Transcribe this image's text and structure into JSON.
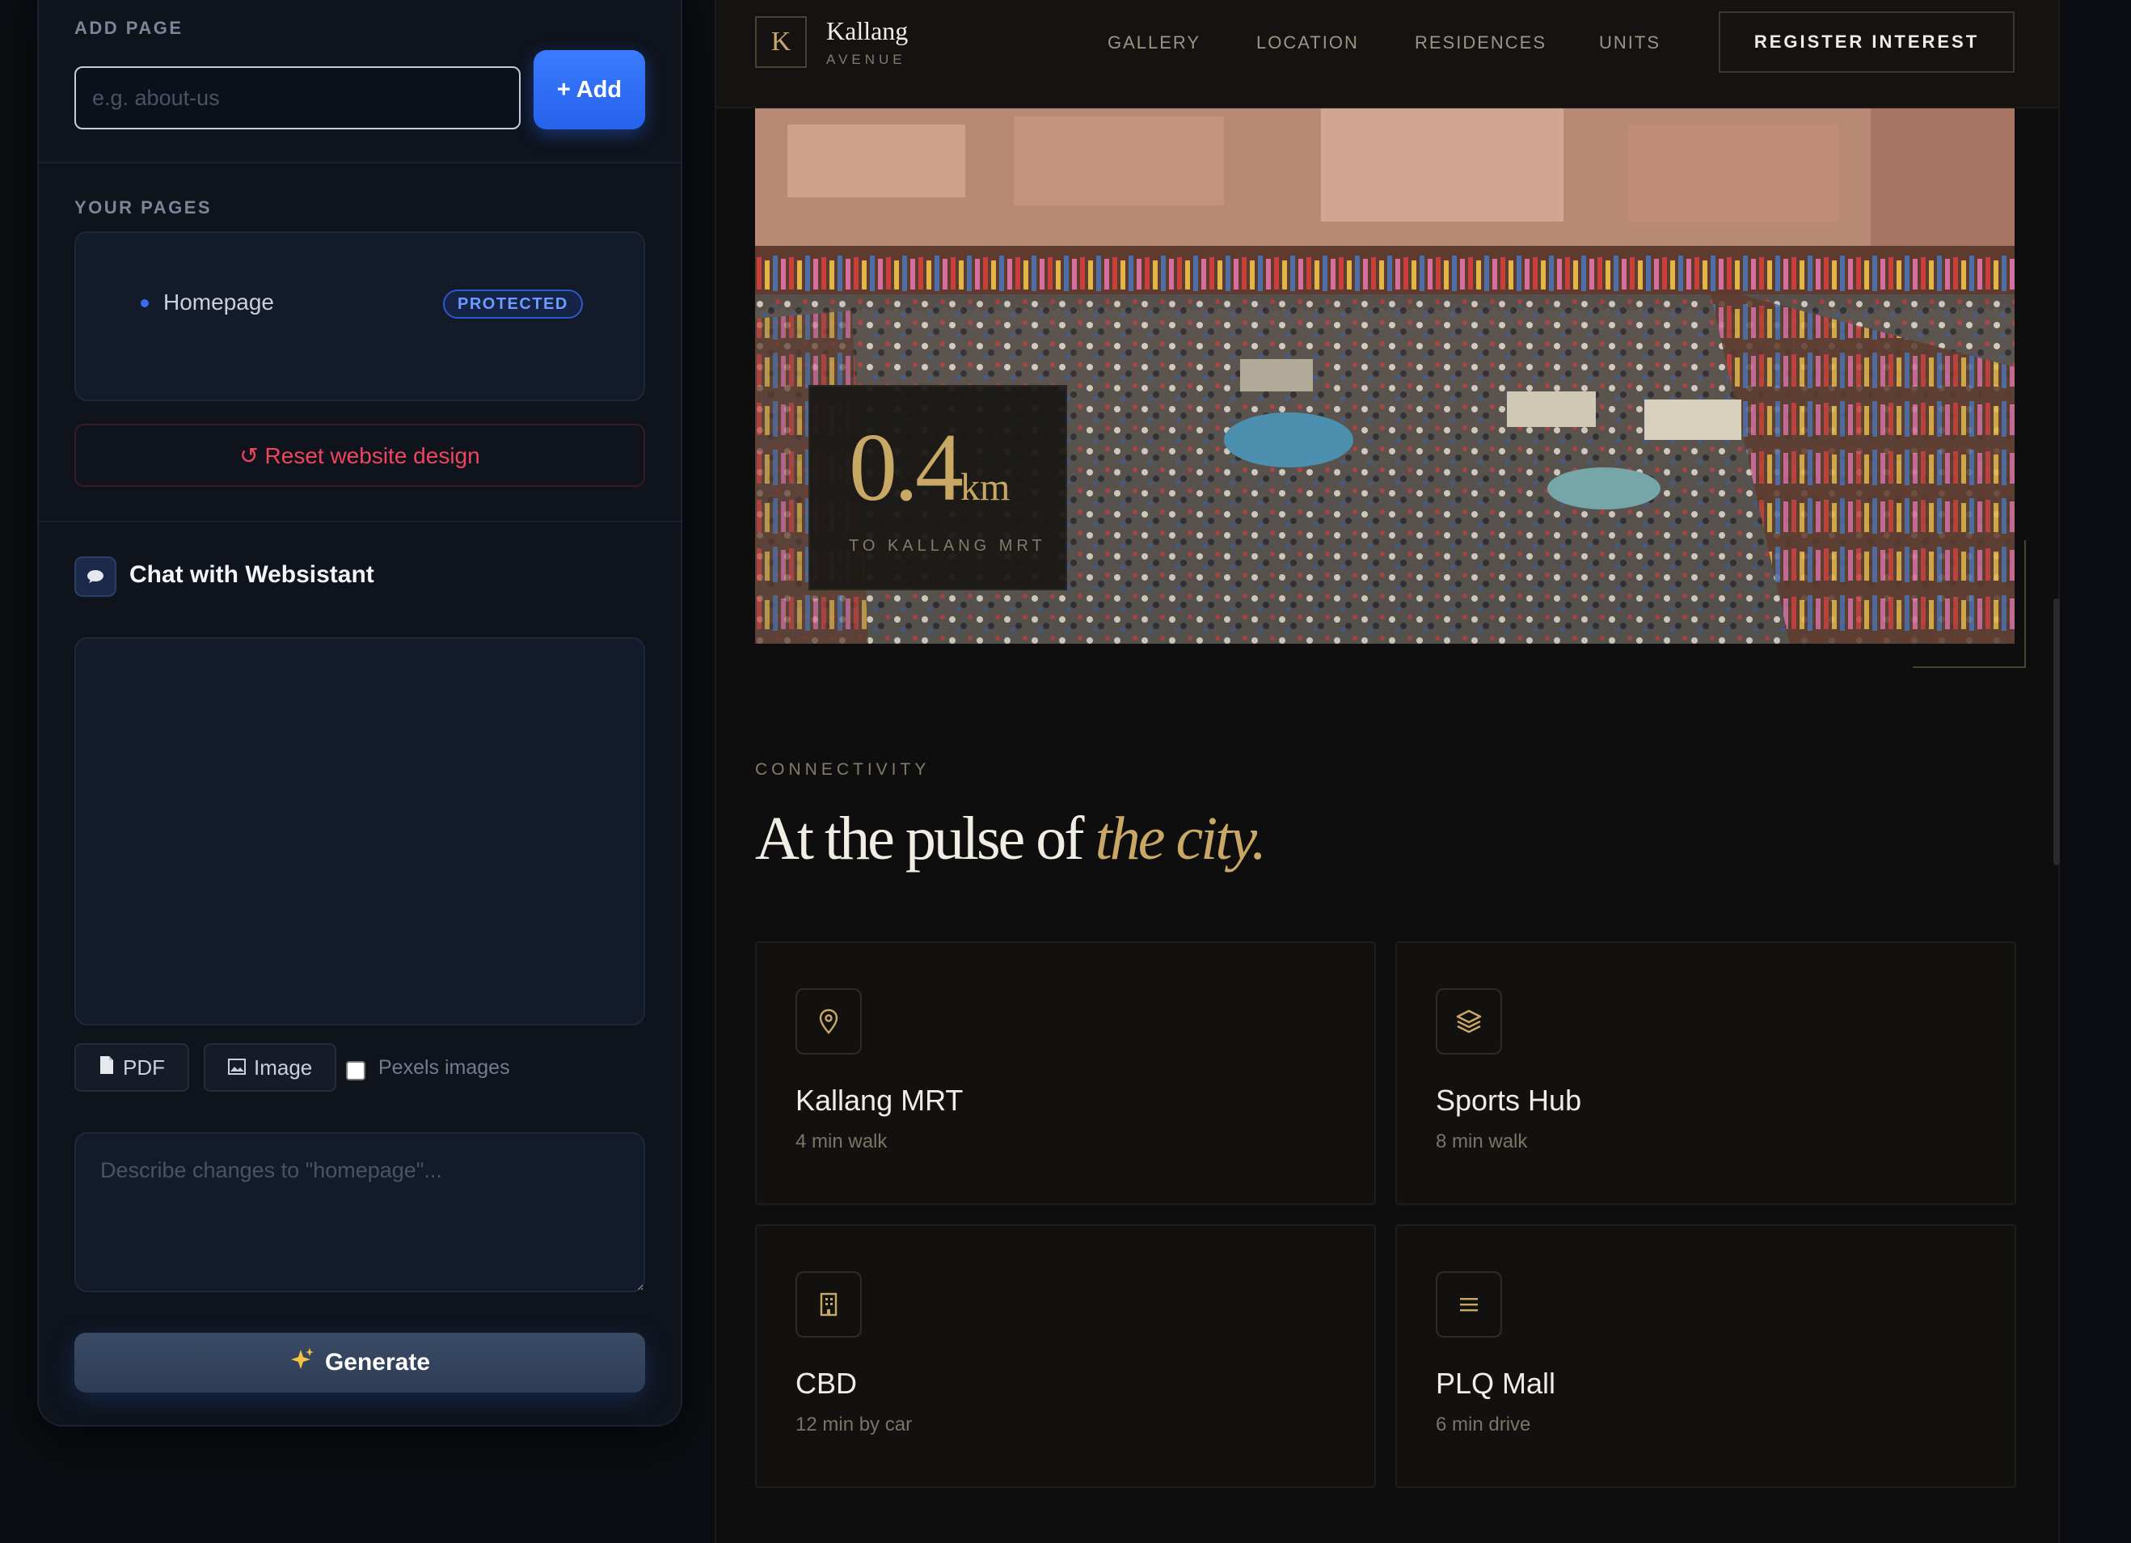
{
  "editor": {
    "add_page": {
      "label": "ADD PAGE",
      "placeholder": "e.g. about-us",
      "button_label": "+ Add"
    },
    "your_pages": {
      "label": "YOUR PAGES",
      "pages": [
        {
          "name": "Homepage",
          "badge": "PROTECTED"
        }
      ]
    },
    "reset_label": "↺ Reset website design",
    "chat": {
      "title": "Chat with Websistant",
      "pdf_label": "PDF",
      "image_label": "Image",
      "pexels_label": "Pexels images",
      "describe_placeholder": "Describe changes to \"homepage\"...",
      "generate_label": "Generate"
    }
  },
  "site": {
    "brand": {
      "mark": "K",
      "name": "Kallang",
      "sub": "AVENUE"
    },
    "nav": [
      "GALLERY",
      "LOCATION",
      "RESIDENCES",
      "UNITS"
    ],
    "register_label": "REGISTER INTEREST",
    "hero_stat": {
      "value": "0.4",
      "unit": "km",
      "label": "TO KALLANG MRT"
    },
    "connectivity": {
      "eyebrow": "CONNECTIVITY",
      "title_plain": "At the pulse of",
      "title_accent": "the city.",
      "places": [
        {
          "title": "Kallang MRT",
          "sub": "4 min walk",
          "icon": "map-pin-icon"
        },
        {
          "title": "Sports Hub",
          "sub": "8 min walk",
          "icon": "layers-icon"
        },
        {
          "title": "CBD",
          "sub": "12 min by car",
          "icon": "building-icon"
        },
        {
          "title": "PLQ Mall",
          "sub": "6 min drive",
          "icon": "menu-lines-icon"
        }
      ]
    }
  },
  "colors": {
    "accent_gold": "#c9a865",
    "button_blue": "#2563eb",
    "danger_red": "#f0445f"
  }
}
